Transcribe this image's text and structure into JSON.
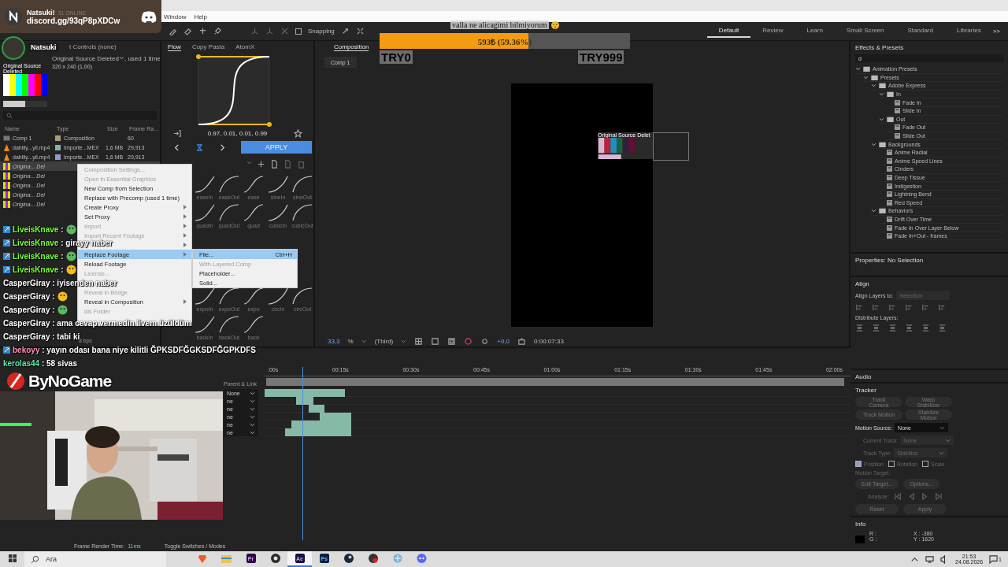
{
  "discord_banner": {
    "server": "Natsuki!",
    "online": "31 ONLINE",
    "invite": "discord.gg/93qP8pXDCw"
  },
  "avatar_label": "Natsuki",
  "menu_bar": [
    "Window",
    "Help"
  ],
  "toolbar": {
    "snapping": {
      "label": "Snapping",
      "checked": false
    }
  },
  "workspaces": [
    {
      "label": "Default",
      "selected": true
    },
    {
      "label": "Review",
      "selected": false
    },
    {
      "label": "Learn",
      "selected": false
    },
    {
      "label": "Small Screen",
      "selected": false
    },
    {
      "label": "Standard",
      "selected": false
    },
    {
      "label": "Libraries",
      "selected": false
    }
  ],
  "workspace_more": ">>",
  "project_panel": {
    "tab": "t Controls (none)",
    "source_name": "Original Source Deleted",
    "source_usage": ", used 1 time",
    "source_size": "320 x 240 (1,00)",
    "thumb_label": "Original Source Deleted",
    "columns": [
      "Name",
      "Type",
      "Size",
      "Frame Ra..."
    ],
    "rows": [
      {
        "kind": "comp",
        "name": "Comp 1",
        "type": "Composition",
        "rate": "60",
        "color": "#a99c7c",
        "selected": false
      },
      {
        "kind": "video",
        "name": "dahiliy...yil.mp4",
        "type": "Importe...MEX",
        "size": "1,6 MB",
        "rate": "29,913",
        "color": "#7fb5a6",
        "selected": false
      },
      {
        "kind": "video",
        "name": "dahiliy...yil.mp4",
        "type": "Importe...MEX",
        "size": "1,6 MB",
        "rate": "29,913",
        "color": "#9a96c8",
        "selected": false
      },
      {
        "kind": "still",
        "name": "Origina... Del",
        "selected": true
      },
      {
        "kind": "still",
        "name": "Origina... Del",
        "selected": false
      },
      {
        "kind": "still",
        "name": "Origina... Del",
        "selected": false
      },
      {
        "kind": "still",
        "name": "Origina... Del",
        "selected": false
      },
      {
        "kind": "still",
        "name": "Origina... Del",
        "selected": false
      }
    ],
    "bpc": "8 bpc"
  },
  "flow_panel": {
    "tabs": [
      {
        "label": "Flow",
        "selected": true
      },
      {
        "label": "Copy Pasta",
        "selected": false
      },
      {
        "label": "AtomX",
        "selected": false
      }
    ],
    "bezier": "0.97, 0.01, 0.01, 0.99",
    "apply": "APPLY",
    "presets": [
      "easeIn",
      "easeOut",
      "ease",
      "sineIn",
      "sineOut",
      "quadIn",
      "quadOut",
      "quad",
      "cubicIn",
      "cubicOut",
      "expoIn",
      "expoOut",
      "expo",
      "circIn",
      "circOut",
      "backIn",
      "backOut",
      "back"
    ]
  },
  "composition": {
    "tab": "Composition",
    "comp_button": "Comp 1",
    "layer_label": "Original Source Delet",
    "zoom": "33,3",
    "zoom_unit": "%",
    "resolution": "(Third)",
    "exposure": "+0,0",
    "timecode": "0:00:07:33"
  },
  "donation": {
    "title": "valla ne alicagimi bilmiyorum",
    "level": 0.5936,
    "amount": "593₺ (59.36%)",
    "min": "TRY0",
    "max": "TRY999"
  },
  "context_menu": [
    {
      "kind": "item",
      "label": "Composition Settings...",
      "disabled": true,
      "submenu": false,
      "selected": false
    },
    {
      "kind": "item",
      "label": "Open in Essential Graphics",
      "disabled": true,
      "submenu": false,
      "selected": false
    },
    {
      "kind": "item",
      "label": "New Comp from Selection",
      "disabled": false,
      "submenu": false,
      "selected": false
    },
    {
      "kind": "item",
      "label": "Replace with Precomp (used 1 time)",
      "disabled": false,
      "submenu": false,
      "selected": false
    },
    {
      "kind": "item",
      "label": "Create Proxy",
      "disabled": false,
      "submenu": true,
      "selected": false
    },
    {
      "kind": "item",
      "label": "Set Proxy",
      "disabled": false,
      "submenu": true,
      "selected": false
    },
    {
      "kind": "item",
      "label": "Import",
      "disabled": true,
      "submenu": true,
      "selected": false
    },
    {
      "kind": "item",
      "label": "Import Recent Footage",
      "disabled": true,
      "submenu": true,
      "selected": false
    },
    {
      "kind": "covered",
      "submenu": true
    },
    {
      "kind": "item",
      "label": "Replace Footage",
      "disabled": false,
      "submenu": true,
      "selected": true
    },
    {
      "kind": "item",
      "label": "Reload Footage",
      "disabled": false,
      "submenu": false,
      "selected": false
    },
    {
      "kind": "item",
      "label": "License...",
      "disabled": true,
      "submenu": false,
      "selected": false
    },
    {
      "kind": "covered",
      "submenu": false
    },
    {
      "kind": "item",
      "label": "Reveal in Bridge",
      "disabled": true,
      "submenu": false,
      "selected": false
    },
    {
      "kind": "item",
      "label": "Reveal in Composition",
      "disabled": false,
      "submenu": true,
      "selected": false
    },
    {
      "kind": "item",
      "label": "ids Folder",
      "disabled": true,
      "submenu": false,
      "selected": false
    },
    {
      "kind": "covered",
      "submenu": false
    }
  ],
  "submenu": [
    {
      "label": "File...",
      "shortcut": "Ctrl+H",
      "disabled": false,
      "selected": true
    },
    {
      "label": "With Layered Comp",
      "disabled": true,
      "selected": false
    },
    {
      "label": "Placeholder...",
      "disabled": false,
      "selected": false
    },
    {
      "label": "Solid...",
      "disabled": false,
      "selected": false
    }
  ],
  "chat": [
    {
      "user": "LiveisKnave",
      "color": "#7cff3a",
      "badge": true,
      "message": ":",
      "emote": true
    },
    {
      "user": "LiveisKnave",
      "color": "#7cff3a",
      "badge": true,
      "message": ": girayy naber",
      "emote": false
    },
    {
      "user": "LiveisKnave",
      "color": "#7cff3a",
      "badge": true,
      "message": ":",
      "emote": true
    },
    {
      "user": "LiveisKnave",
      "color": "#7cff3a",
      "badge": true,
      "message": ":",
      "emote": true
    },
    {
      "user": "CasperGiray",
      "color": "#ffffff",
      "badge": false,
      "message": ": iyisenden naber",
      "emote": false
    },
    {
      "user": "CasperGiray",
      "color": "#ffffff",
      "badge": false,
      "message": ":",
      "emote": true
    },
    {
      "user": "CasperGiray",
      "color": "#ffffff",
      "badge": false,
      "message": ":",
      "emote": true
    },
    {
      "user": "CasperGiray",
      "color": "#ffffff",
      "badge": false,
      "message": ": ama cevap vermedin livem üzüldüm",
      "emote": false
    },
    {
      "user": "CasperGiray",
      "color": "#ffffff",
      "badge": false,
      "message": ": tabi ki",
      "emote": false
    },
    {
      "user": "bekoyy",
      "color": "#ff8fb8",
      "badge": true,
      "message": ": yayın odası bana niye kilitli ĞPKSDFĞGKSDFĞGPKDFS",
      "emote": false
    },
    {
      "user": "kerolas44",
      "color": "#5fe8a8",
      "badge": false,
      "message": ": 58 sivas",
      "emote": false
    }
  ],
  "brand": "ByNoGame",
  "timeline": {
    "parent_header": "Parent & Link",
    "ticks": [
      ":00s",
      "00:15s",
      "00:30s",
      "00:45s",
      "01:00s",
      "01:15s",
      "01:30s",
      "01:45s",
      "02:00s"
    ],
    "layers": [
      "None",
      "ne",
      "ne",
      "ne",
      "ne",
      "ne"
    ],
    "render_label": "Frame Render Time:",
    "render_value": "11ms",
    "toggle": "Toggle Switches / Modes"
  },
  "effects": {
    "title": "Effects & Presets",
    "search": "d",
    "tree": [
      {
        "label": "Animation Presets",
        "expanded": true,
        "children": [
          {
            "label": "Presets",
            "expanded": true,
            "children": [
              {
                "label": "Adobe Express",
                "expanded": true,
                "children": [
                  {
                    "label": "In",
                    "expanded": true,
                    "children": [
                      {
                        "label": "Fade In"
                      },
                      {
                        "label": "Slide In"
                      }
                    ]
                  },
                  {
                    "label": "Out",
                    "expanded": true,
                    "children": [
                      {
                        "label": "Fade Out"
                      },
                      {
                        "label": "Slide Out"
                      }
                    ]
                  }
                ]
              },
              {
                "label": "Backgrounds",
                "expanded": true,
                "children": [
                  {
                    "label": "Anime Radial"
                  },
                  {
                    "label": "Anime Speed Lines"
                  },
                  {
                    "label": "Cinders"
                  },
                  {
                    "label": "Deep Tissue"
                  },
                  {
                    "label": "Indigestion"
                  },
                  {
                    "label": "Lightning Bend"
                  },
                  {
                    "label": "Red Speed"
                  }
                ]
              },
              {
                "label": "Behaviors",
                "expanded": true,
                "children": [
                  {
                    "label": "Drift Over Time"
                  },
                  {
                    "label": "Fade In Over Layer Below"
                  },
                  {
                    "label": "Fade In+Out - frames"
                  }
                ]
              }
            ]
          }
        ]
      }
    ]
  },
  "properties": {
    "title": "Properties: No Selection"
  },
  "align": {
    "title": "Align",
    "layers_to": "Align Layers to:",
    "target": "Selection",
    "distribute": "Distribute Layers:"
  },
  "audio": {
    "title": "Audio"
  },
  "tracker": {
    "title": "Tracker",
    "buttons": [
      "Track Camera",
      "Warp Stabilizer",
      "Track Motion",
      "Stabilize Motion"
    ],
    "fields": [
      {
        "label": "Motion Source:",
        "value": "None",
        "disabled": false
      },
      {
        "label": "Current Track:",
        "value": "None",
        "disabled": true
      },
      {
        "label": "Track Type:",
        "value": "Stabilize",
        "disabled": true
      }
    ],
    "checks": [
      {
        "label": "Position",
        "checked": true
      },
      {
        "label": "Rotation",
        "checked": false
      },
      {
        "label": "Scale",
        "checked": false
      }
    ],
    "motion_target": "Motion Target:",
    "target_buttons": [
      "Edit Target...",
      "Options..."
    ],
    "analyze": "Analyze:",
    "final_buttons": [
      "Reset",
      "Apply"
    ]
  },
  "info": {
    "title": "Info",
    "r": "R :",
    "g": "G :",
    "x": "X : -380",
    "y": "Y : 1620"
  },
  "taskbar": {
    "search": "Ara",
    "apps": [
      {
        "kind": "brave",
        "selected": false
      },
      {
        "kind": "files",
        "selected": false
      },
      {
        "kind": "pr",
        "label": "Pr",
        "selected": false
      },
      {
        "kind": "obs",
        "selected": false
      },
      {
        "kind": "ae",
        "label": "Ae",
        "selected": true
      },
      {
        "kind": "ps",
        "label": "Ps",
        "selected": false
      },
      {
        "kind": "steam",
        "selected": false
      },
      {
        "kind": "record",
        "selected": false
      },
      {
        "kind": "network",
        "selected": false
      },
      {
        "kind": "discord",
        "selected": false
      }
    ],
    "time": "21:53",
    "date": "24.08.2026",
    "notifications": "1"
  }
}
